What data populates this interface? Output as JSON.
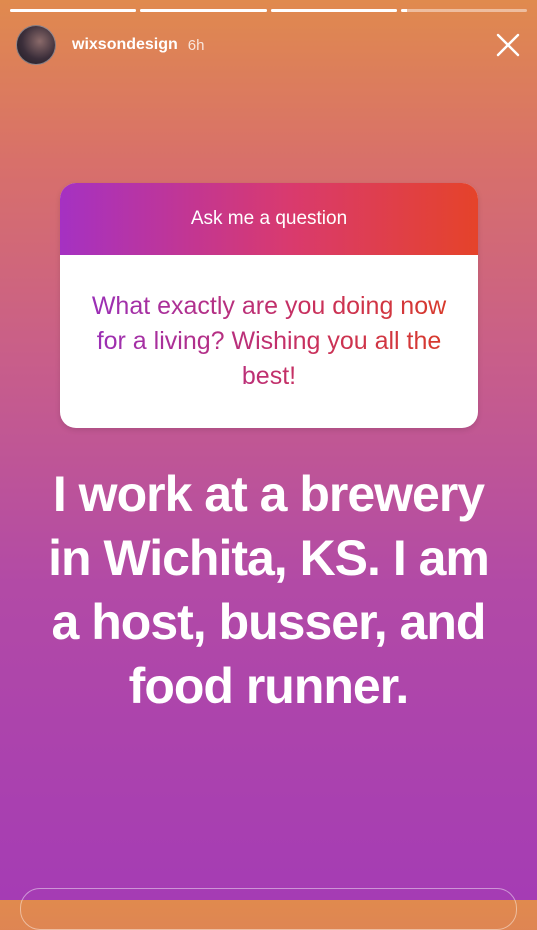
{
  "progress": [
    1.0,
    1.0,
    1.0,
    0.05
  ],
  "header": {
    "username": "wixsondesign",
    "time": "6h"
  },
  "question_card": {
    "title": "Ask me a question",
    "question": "What exactly are you doing now for a living? Wishing you all the best!"
  },
  "answer": "I work at a brewery in Wichita, KS. I am a host, busser, and food runner.",
  "icons": {
    "avatar": "avatar-image",
    "close": "close-icon"
  }
}
